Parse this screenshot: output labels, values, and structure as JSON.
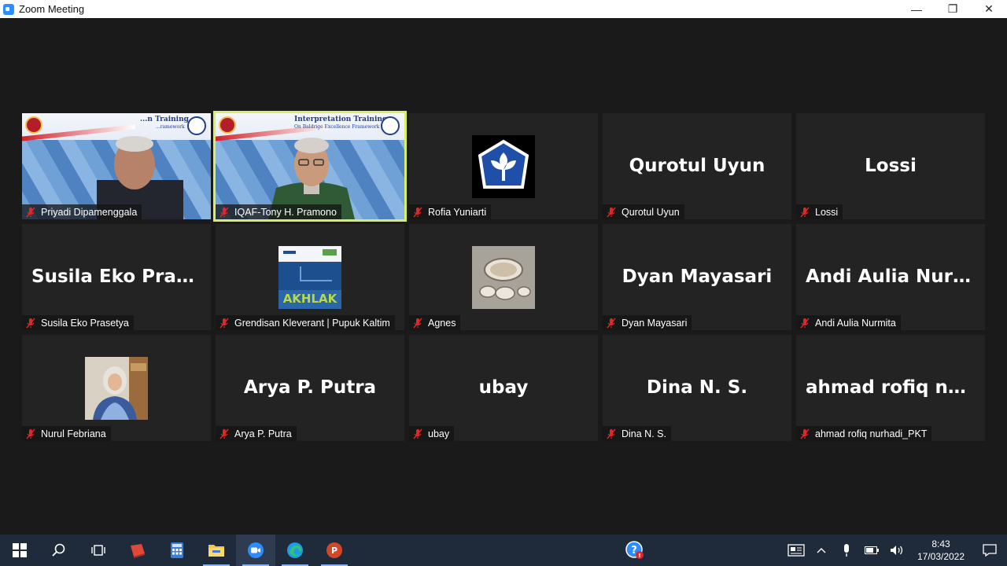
{
  "window": {
    "title": "Zoom Meeting",
    "controls": [
      "—",
      "❐",
      "✕"
    ]
  },
  "participants": [
    {
      "name": "Priyadi Dipamenggala",
      "display": "",
      "type": "video",
      "active": false
    },
    {
      "name": "IQAF-Tony H. Pramono",
      "display": "",
      "type": "video",
      "active": true
    },
    {
      "name": "Rofia Yuniarti",
      "display": "",
      "type": "avatar",
      "avatar": "logo-avatar",
      "active": false
    },
    {
      "name": "Qurotul Uyun",
      "display": "Qurotul Uyun",
      "type": "text",
      "active": false
    },
    {
      "name": "Lossi",
      "display": "Lossi",
      "type": "text",
      "active": false
    },
    {
      "name": "Susila Eko Prasetya",
      "display": "Susila Eko Praset...",
      "type": "text",
      "active": false
    },
    {
      "name": "Grendisan Kleverant | Pupuk Kaltim",
      "display": "",
      "type": "avatar",
      "avatar": "akhlak-avatar",
      "active": false
    },
    {
      "name": "Agnes",
      "display": "",
      "type": "avatar",
      "avatar": "cups-avatar",
      "active": false
    },
    {
      "name": "Dyan Mayasari",
      "display": "Dyan Mayasari",
      "type": "text",
      "active": false
    },
    {
      "name": "Andi Aulia Nurmita",
      "display": "Andi Aulia Nurm...",
      "type": "text",
      "active": false
    },
    {
      "name": "Nurul Febriana",
      "display": "",
      "type": "avatar",
      "avatar": "photo-avatar",
      "active": false
    },
    {
      "name": "Arya P. Putra",
      "display": "Arya P. Putra",
      "type": "text",
      "active": false
    },
    {
      "name": "ubay",
      "display": "ubay",
      "type": "text",
      "active": false
    },
    {
      "name": "Dina N. S.",
      "display": "Dina N. S.",
      "type": "text",
      "active": false
    },
    {
      "name": "ahmad rofiq nurhadi_PKT",
      "display": "ahmad rofiq nur...",
      "type": "text",
      "active": false
    }
  ],
  "video_banner": {
    "title": "Interpretation Training",
    "subtitle": "On Baldrige Excellence Framework",
    "left_title": "...n Training",
    "left_subtitle": "...ramework"
  },
  "avatar_akhlak": {
    "text": "AKHLAK"
  },
  "taskbar": {
    "apps": [
      "windows-start-icon",
      "search-icon",
      "task-view-icon",
      "red-app-icon",
      "calculator-icon",
      "file-explorer-icon",
      "zoom-icon",
      "edge-icon",
      "powerpoint-icon"
    ],
    "clock_time": "8:43",
    "clock_date": "17/03/2022",
    "powerpoint_letter": "P"
  },
  "colors": {
    "active_speaker": "#d9ef63",
    "mute_red": "#e02828",
    "taskbar": "#1f2a3a"
  }
}
